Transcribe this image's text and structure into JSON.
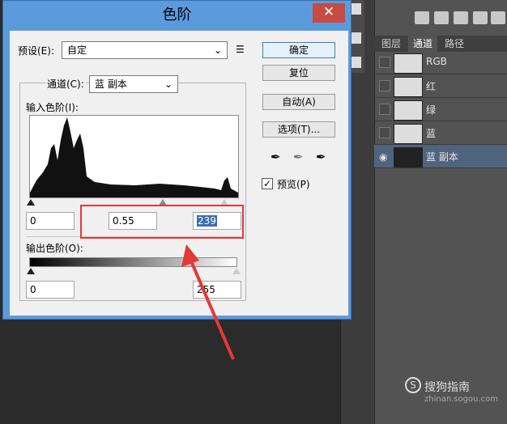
{
  "dialog": {
    "title": "色阶",
    "close_icon": "✕",
    "preset_label": "预设(E):",
    "preset_value": "自定",
    "channel_label": "通道(C):",
    "channel_value": "蓝 副本",
    "input_levels_label": "输入色阶(I):",
    "input_black": "0",
    "input_gamma": "0.55",
    "input_white": "239",
    "output_levels_label": "输出色阶(O):",
    "output_black": "0",
    "output_white": "255",
    "buttons": {
      "ok": "确定",
      "reset": "复位",
      "auto": "自动(A)",
      "options": "选项(T)..."
    },
    "preview_label": "预览(P)",
    "preview_checked": true
  },
  "panel": {
    "tabs": [
      "图层",
      "通道",
      "路径"
    ],
    "active_tab": "通道",
    "channels": [
      {
        "name": "RGB"
      },
      {
        "name": "红"
      },
      {
        "name": "绿"
      },
      {
        "name": "蓝"
      },
      {
        "name": "蓝 副本",
        "selected": true
      }
    ]
  },
  "watermark": {
    "text": "搜狗指南",
    "url": "zhinan.sogou.com"
  },
  "colors": {
    "annotation": "#e53935",
    "dialog_border": "#5b9bdc",
    "selected_row": "#50647e"
  }
}
